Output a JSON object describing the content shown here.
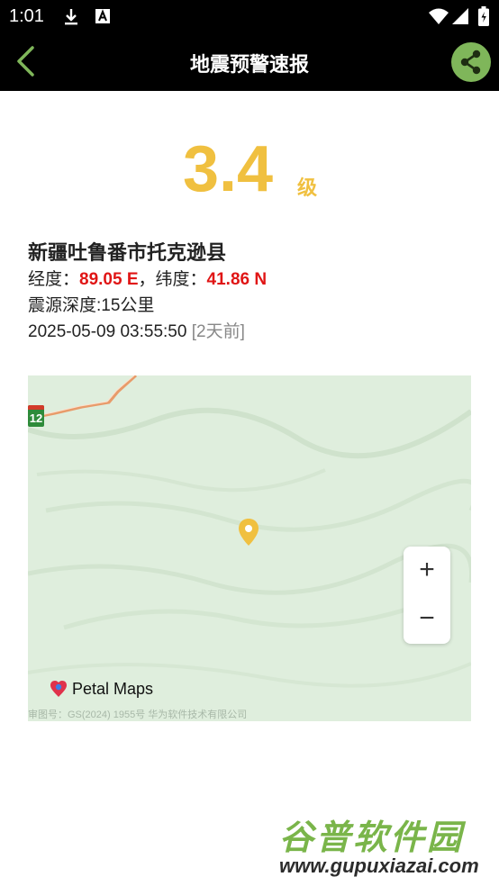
{
  "status_bar": {
    "time": "1:01",
    "icons": [
      "download-icon",
      "a-badge-icon",
      "wifi-icon",
      "signal-icon",
      "battery-icon"
    ]
  },
  "app_bar": {
    "title": "地震预警速报",
    "back_icon": "chevron-left-icon",
    "share_icon": "share-icon"
  },
  "magnitude": {
    "value": "3.4",
    "unit": "级"
  },
  "quake": {
    "location": "新疆吐鲁番市托克逊县",
    "longitude_label": "经度：",
    "longitude": "89.05 E",
    "separator": "，",
    "latitude_label": "纬度：",
    "latitude": "41.86 N",
    "depth": "震源深度:15公里",
    "datetime": "2025-05-09 03:55:50",
    "ago": "[2天前]"
  },
  "map": {
    "road_badge": "12",
    "zoom_in": "+",
    "zoom_out": "−",
    "brand": "Petal Maps",
    "copyright": "审图号：GS(2024) 1955号 华为软件技术有限公司"
  },
  "watermark": {
    "cn": "谷普软件园",
    "url": "www.gupuxiazai.com"
  },
  "colors": {
    "magnitude": "#f0c040",
    "coord": "#e01515",
    "share_bg": "#7fb65a",
    "map_bg": "#dfeedd"
  }
}
